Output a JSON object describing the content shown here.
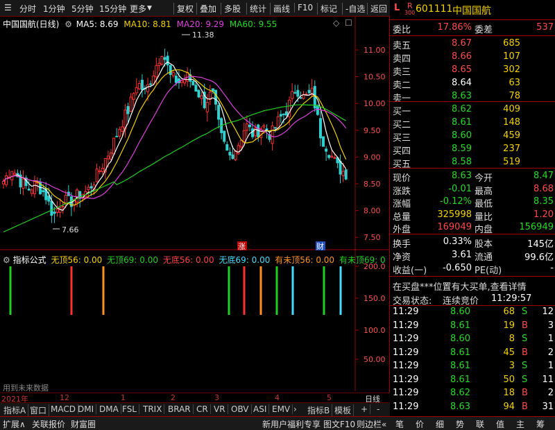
{
  "toolbar": {
    "items": [
      "分时",
      "1分钟",
      "5分钟",
      "15分钟",
      "更多",
      "复权",
      "叠加",
      "多股",
      "统计",
      "画线",
      "F10",
      "标记",
      "-自选",
      "返回"
    ]
  },
  "stock": {
    "title": "中国国航(日线)",
    "code": "601111",
    "name": "中国国航",
    "prefix_l": "L",
    "prefix_r": "R",
    "prefix_sub": "300"
  },
  "ma": {
    "ma5": "MA5: 8.69",
    "ma10": "MA10: 8.81",
    "ma20": "MA20: 9.29",
    "ma60": "MA60: 9.55"
  },
  "colors": {
    "ma5": "#ffffff",
    "ma10": "#f5d200",
    "ma20": "#e040e0",
    "ma60": "#20d020",
    "up": "#ff3030",
    "down": "#30d0d0"
  },
  "price_axis": [
    "11.00",
    "10.50",
    "10.00",
    "9.50",
    "9.00",
    "8.50",
    "8.00",
    "7.50"
  ],
  "annotations": {
    "high": "11.38",
    "low": "7.66",
    "tag_zhang": "涨",
    "tag_cai": "财"
  },
  "indicator": {
    "title": "指标公式",
    "w56": "无顶56: 0.00",
    "w69": "无顶69: 0.00",
    "wd56": "无底56: 0.00",
    "wd69": "无底69: 0.00",
    "ywd56": "有未顶56: 0.00",
    "ywd69": "有未顶69: 0",
    "axis": [
      "200.0",
      "150.0",
      "100.0",
      "50.00"
    ],
    "note": "用到未来数据"
  },
  "timeaxis": {
    "labels": [
      "2021年",
      "12",
      "1",
      "2",
      "3",
      "4",
      "5"
    ],
    "period": "日线"
  },
  "tabs": [
    "指标A",
    "窗口",
    "MACD",
    "DMI",
    "DMA",
    "FSL",
    "TRIX",
    "BRAR",
    "CR",
    "VR",
    "OBV",
    "ASI",
    "EMV",
    "指标B",
    "模板",
    "+",
    "-"
  ],
  "bottom": {
    "left": [
      "扩展∧",
      "关联报价",
      "财富圈"
    ],
    "mid": "新用户福利专享",
    "right": [
      "图文F10",
      "则边栏«"
    ],
    "icons": [
      "笔",
      "价",
      "细",
      "势",
      "联",
      "值",
      "主",
      "筹"
    ]
  },
  "orderbook": {
    "webi_label": "委比",
    "webi": "17.86%",
    "weicha_label": "委差",
    "weicha": "537",
    "sells": [
      {
        "label": "卖五",
        "price": "8.67",
        "vol": "685"
      },
      {
        "label": "卖四",
        "price": "8.66",
        "vol": "107"
      },
      {
        "label": "卖三",
        "price": "8.65",
        "vol": "302"
      },
      {
        "label": "卖二",
        "price": "8.64",
        "vol": "63"
      },
      {
        "label": "卖一",
        "price": "8.63",
        "vol": "78"
      }
    ],
    "buys": [
      {
        "label": "买一",
        "price": "8.62",
        "vol": "409"
      },
      {
        "label": "买二",
        "price": "8.61",
        "vol": "148"
      },
      {
        "label": "买三",
        "price": "8.60",
        "vol": "459"
      },
      {
        "label": "买四",
        "price": "8.59",
        "vol": "237"
      },
      {
        "label": "买五",
        "price": "8.58",
        "vol": "519"
      }
    ]
  },
  "quote": [
    {
      "l1": "现价",
      "v1": "8.63",
      "l2": "今开",
      "v2": "8.47"
    },
    {
      "l1": "涨跌",
      "v1": "-0.01",
      "l2": "最高",
      "v2": "8.68"
    },
    {
      "l1": "涨幅",
      "v1": "-0.12%",
      "l2": "最低",
      "v2": "8.35"
    },
    {
      "l1": "总量",
      "v1": "325998",
      "l2": "量比",
      "v2": "1.20"
    },
    {
      "l1": "外盘",
      "v1": "169049",
      "l2": "内盘",
      "v2": "156949"
    }
  ],
  "fund": [
    {
      "l1": "换手",
      "v1": "0.33%",
      "l2": "股本",
      "v2": "145亿"
    },
    {
      "l1": "净资",
      "v1": "3.61",
      "l2": "流通",
      "v2": "99.6亿"
    },
    {
      "l1": "收益(一)",
      "v1": "-0.650",
      "l2": "PE(动)",
      "v2": "-"
    }
  ],
  "notice": "在买盘***位置有大买单,查看详情",
  "status": {
    "label": "交易状态:",
    "value": "连续竞价",
    "time": "11:29:57"
  },
  "trades": [
    {
      "t": "11:29",
      "p": "8.60",
      "v": "68",
      "d": "S",
      "n": "12"
    },
    {
      "t": "11:29",
      "p": "8.61",
      "v": "19",
      "d": "B",
      "n": "3"
    },
    {
      "t": "11:29",
      "p": "8.60",
      "v": "8",
      "d": "S",
      "n": "1"
    },
    {
      "t": "11:29",
      "p": "8.61",
      "v": "45",
      "d": "B",
      "n": "2"
    },
    {
      "t": "11:29",
      "p": "8.61",
      "v": "3",
      "d": "S",
      "n": "1"
    },
    {
      "t": "11:29",
      "p": "8.61",
      "v": "50",
      "d": "S",
      "n": "11"
    },
    {
      "t": "11:29",
      "p": "8.62",
      "v": "18",
      "d": "B",
      "n": "2"
    },
    {
      "t": "11:29",
      "p": "8.63",
      "v": "94",
      "d": "B",
      "n": "31"
    }
  ]
}
